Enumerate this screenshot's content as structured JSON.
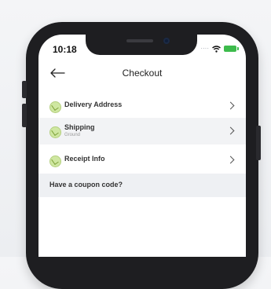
{
  "status_bar": {
    "time": "10:18",
    "signal": "····",
    "icons": [
      "signal-dots-icon",
      "wifi-icon",
      "battery-icon"
    ],
    "battery_color": "#3dbb4c"
  },
  "header": {
    "title": "Checkout",
    "back_icon": "back-arrow-icon"
  },
  "rows": [
    {
      "label": "Delivery Address",
      "sub": "",
      "icon": "checkout-step-icon"
    },
    {
      "label": "Shipping",
      "sub": "Ground",
      "icon": "checkout-step-icon"
    },
    {
      "label": "Receipt Info",
      "sub": "",
      "icon": "checkout-step-icon"
    }
  ],
  "coupon": {
    "label": "Have a coupon code?"
  },
  "colors": {
    "row_alt": "#f2f3f5",
    "icon_fill": "#cfe7a1",
    "phone_frame": "#1e1e21"
  }
}
